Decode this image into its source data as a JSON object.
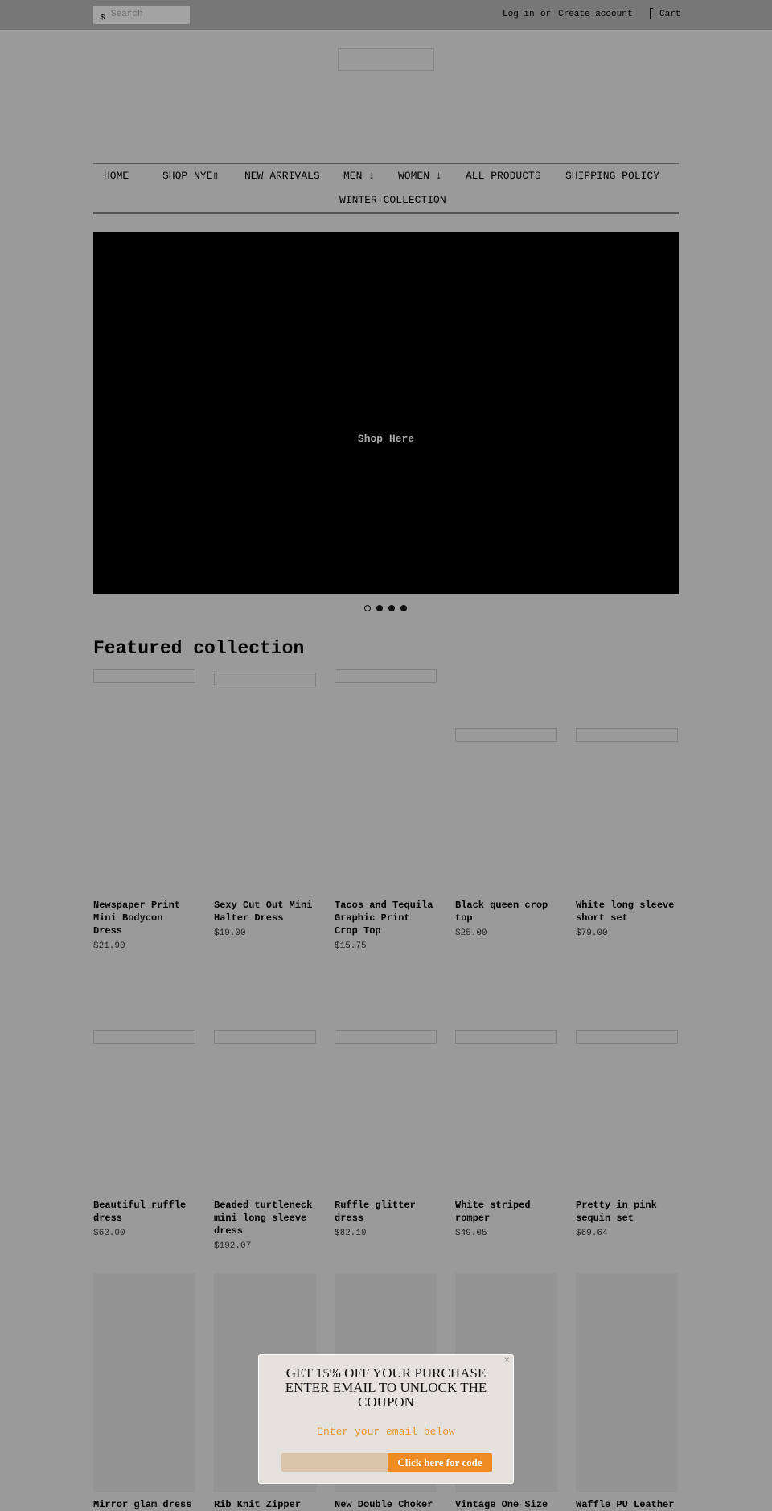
{
  "header": {
    "search_placeholder": "Search",
    "search_icon": "$",
    "login": "Log in",
    "or": "or",
    "create_account": "Create account",
    "cart_icon": "[",
    "cart": "Cart"
  },
  "nav": {
    "items": [
      "HOME",
      "SHOP NYE▯",
      "NEW ARRIVALS",
      "MEN ↓",
      "WOMEN ↓",
      "ALL PRODUCTS",
      "SHIPPING POLICY",
      "WINTER COLLECTION"
    ]
  },
  "hero": {
    "label": "Shop Here",
    "slides": 4,
    "active_slide": 1
  },
  "featured": {
    "title": "Featured collection",
    "products": [
      {
        "title": "Newspaper Print Mini Bodycon Dress",
        "price": "$21.90"
      },
      {
        "title": "Sexy Cut Out Mini Halter Dress",
        "price": "$19.00"
      },
      {
        "title": "Tacos and Tequila Graphic Print Crop Top",
        "price": "$15.75"
      },
      {
        "title": "Black queen crop top",
        "price": "$25.00"
      },
      {
        "title": "White long sleeve short set",
        "price": "$79.00"
      },
      {
        "title": "Beautiful ruffle dress",
        "price": "$62.00"
      },
      {
        "title": "Beaded turtleneck mini long sleeve dress",
        "price": "$192.07"
      },
      {
        "title": "Ruffle glitter dress",
        "price": "$82.10"
      },
      {
        "title": "White striped romper",
        "price": "$49.05"
      },
      {
        "title": "Pretty in pink sequin set",
        "price": "$69.64"
      },
      {
        "title": "Mirror glam dress",
        "price": ""
      },
      {
        "title": "Rib Knit Zipper",
        "price": ""
      },
      {
        "title": "New Double Choker",
        "price": ""
      },
      {
        "title": "Vintage One Size",
        "price": ""
      },
      {
        "title": "Waffle PU Leather",
        "price": ""
      }
    ]
  },
  "popup": {
    "heading": "GET 15% OFF YOUR PURCHASE ENTER EMAIL TO UNLOCK THE COUPON",
    "close": "×",
    "subtitle": "Enter your email below",
    "email_value": "",
    "button": "Click here for code",
    "accent": "#f08a22"
  }
}
